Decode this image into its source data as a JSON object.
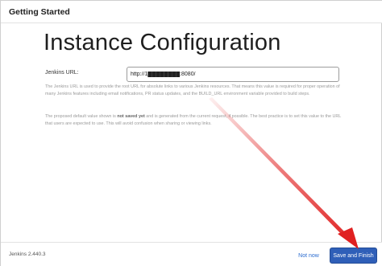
{
  "header": {
    "title": "Getting Started"
  },
  "main": {
    "title": "Instance Configuration",
    "url_label": "Jenkins URL:",
    "url_value": "http://1████████:8080/",
    "help_1": "The Jenkins URL is used to provide the root URL for absolute links to various Jenkins resources. That means this value is required for proper operation of many Jenkins features including email notifications, PR status updates, and the BUILD_URL environment variable provided to build steps.",
    "help_2_a": "The proposed default value shown is ",
    "help_2_bold": "not saved yet",
    "help_2_b": " and is generated from the current request, if possible. The best practice is to set this value to the URL that users are expected to use. This will avoid confusion when sharing or viewing links."
  },
  "footer": {
    "version": "Jenkins 2.440.3",
    "not_now_label": "Not now",
    "save_label": "Save and Finish"
  },
  "colors": {
    "primary_button": "#2f5fb8",
    "link": "#2b6cd0",
    "annotation_arrow": "#e02020"
  }
}
